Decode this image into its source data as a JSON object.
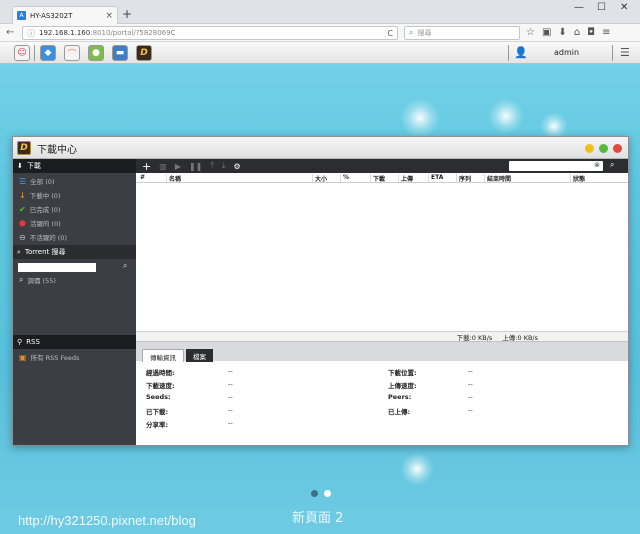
{
  "browser": {
    "tab_title": "HY-AS3202T",
    "tab_close": "×",
    "new_tab": "+",
    "url_host": "192.168.1.160",
    "url_rest": ":8010/portal/?5828069C",
    "reload": "C",
    "search_placeholder": "搜尋",
    "min": "—",
    "max": "☐",
    "close": "✕"
  },
  "nas": {
    "username": "admin"
  },
  "window": {
    "title": "下載中心",
    "logo": "D"
  },
  "sidebar": {
    "download_header": "下載",
    "items": [
      {
        "label": "全部 (0)",
        "color": "#4a9fe0"
      },
      {
        "label": "下載中 (0)",
        "color": "#f0a020"
      },
      {
        "label": "已完成 (0)",
        "color": "#4fbe3a"
      },
      {
        "label": "活躍的 (0)",
        "color": "#e23b3b"
      },
      {
        "label": "不活躍的 (0)",
        "color": "#bbbbbb"
      }
    ],
    "torrent_header": "Torrent 搜尋",
    "search_result": "調價 (55)",
    "rss_header": "RSS",
    "rss_item": "所有 RSS Feeds"
  },
  "columns": [
    "#",
    "名稱",
    "大小",
    "%",
    "下載",
    "上傳",
    "ETA",
    "序列",
    "結束時間",
    "狀態"
  ],
  "status": {
    "download": "下載:0 KB/s",
    "upload": "上傳:0 KB/s"
  },
  "detail_tabs": [
    "傳輸資訊",
    "檔案"
  ],
  "details_left": [
    {
      "label": "經過時間:",
      "value": "--"
    },
    {
      "label": "下載速度:",
      "value": "--"
    },
    {
      "label": "Seeds:",
      "value": "--"
    },
    {
      "label": "已下載:",
      "value": "--"
    },
    {
      "label": "分享率:",
      "value": "--"
    }
  ],
  "details_right": [
    {
      "label": "下載位置:",
      "value": "--"
    },
    {
      "label": "上傳速度:",
      "value": "--"
    },
    {
      "label": "Peers:",
      "value": "--"
    },
    {
      "label": "已上傳:",
      "value": "--"
    }
  ],
  "page_name": "新頁面 2",
  "watermark": "http://hy321250.pixnet.net/blog"
}
